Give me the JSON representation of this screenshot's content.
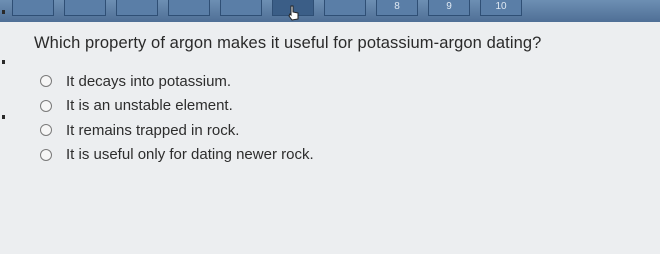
{
  "nav": {
    "items": [
      {
        "label": ""
      },
      {
        "label": ""
      },
      {
        "label": ""
      },
      {
        "label": ""
      },
      {
        "label": ""
      },
      {
        "label": ""
      },
      {
        "label": ""
      },
      {
        "label": "8"
      },
      {
        "label": "9"
      },
      {
        "label": "10"
      }
    ]
  },
  "question": {
    "text": "Which property of argon makes it useful for potassium-argon dating?"
  },
  "options": [
    {
      "label": "It decays into potassium."
    },
    {
      "label": "It is an unstable element."
    },
    {
      "label": "It remains trapped in rock."
    },
    {
      "label": "It is useful only for dating newer rock."
    }
  ],
  "colors": {
    "nav_bar": "#5a7ea7",
    "background": "#eceef0"
  }
}
